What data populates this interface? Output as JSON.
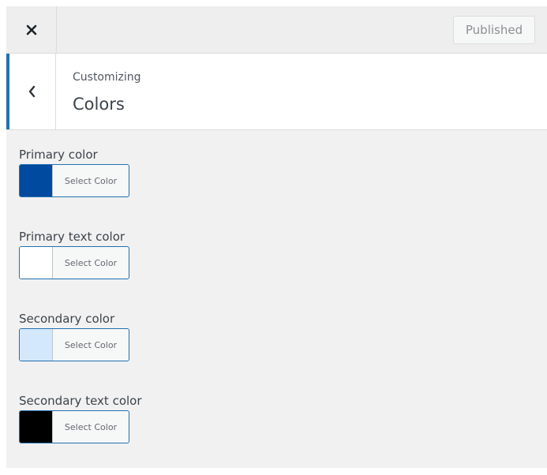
{
  "header": {
    "close_icon": "close-icon",
    "publish_label": "Published"
  },
  "section": {
    "back_icon": "chevron-left-icon",
    "breadcrumb": "Customizing",
    "title": "Colors"
  },
  "colors": {
    "accent": "#2271b1"
  },
  "controls": [
    {
      "label": "Primary color",
      "button_label": "Select Color",
      "swatch": "#004a9f"
    },
    {
      "label": "Primary text color",
      "button_label": "Select Color",
      "swatch": "#ffffff"
    },
    {
      "label": "Secondary color",
      "button_label": "Select Color",
      "swatch": "#d3e8fb"
    },
    {
      "label": "Secondary text color",
      "button_label": "Select Color",
      "swatch": "#000000"
    }
  ]
}
